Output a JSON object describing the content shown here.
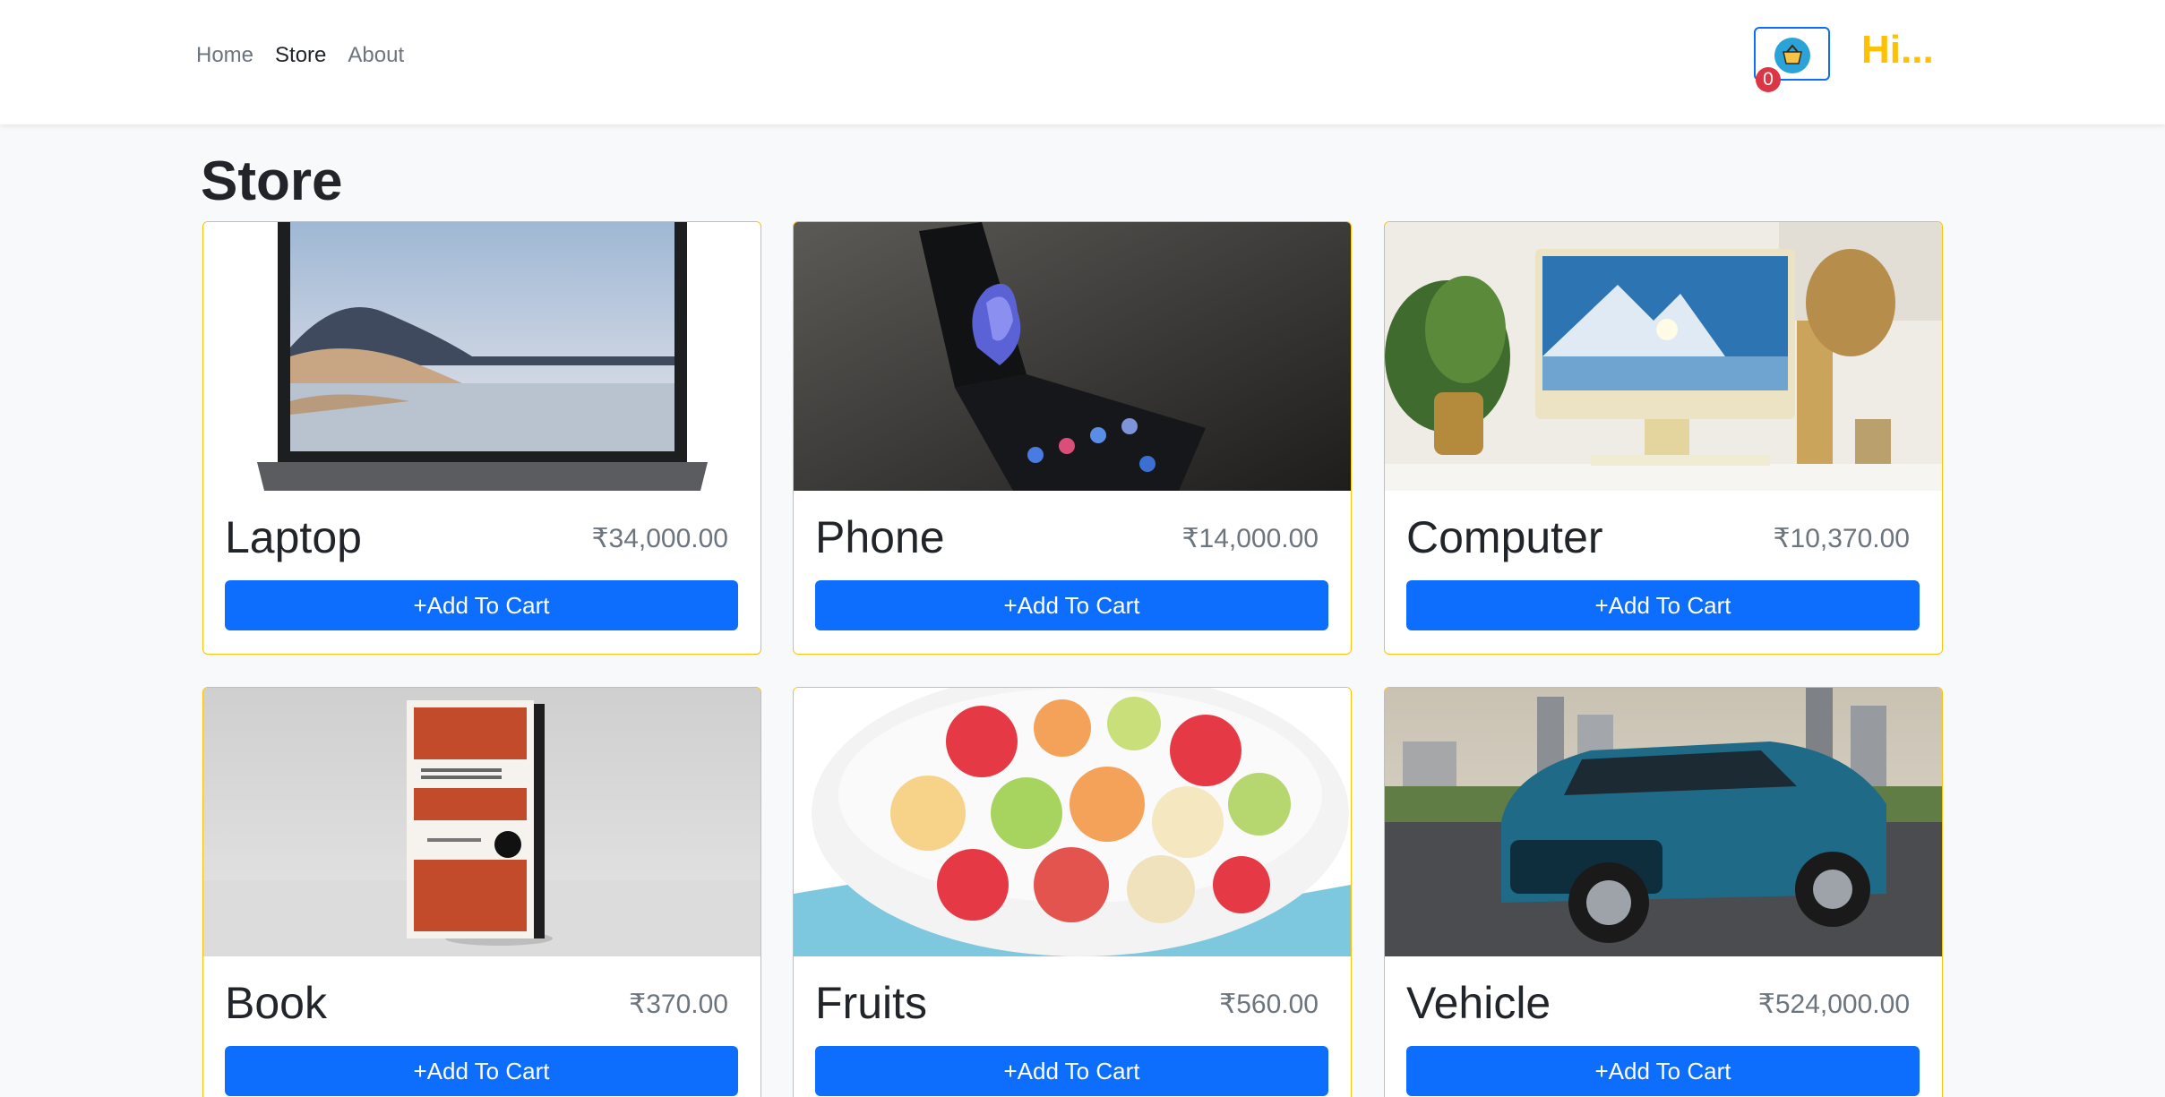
{
  "nav": {
    "links": [
      {
        "label": "Home",
        "active": false
      },
      {
        "label": "Store",
        "active": true
      },
      {
        "label": "About",
        "active": false
      }
    ],
    "cart_count": "0",
    "greeting": "Hi..."
  },
  "page": {
    "title": "Store"
  },
  "products": [
    {
      "name": "Laptop",
      "price": "₹34,000.00",
      "button": "+Add To Cart"
    },
    {
      "name": "Phone",
      "price": "₹14,000.00",
      "button": "+Add To Cart"
    },
    {
      "name": "Computer",
      "price": "₹10,370.00",
      "button": "+Add To Cart"
    },
    {
      "name": "Book",
      "price": "₹370.00",
      "button": "+Add To Cart"
    },
    {
      "name": "Fruits",
      "price": "₹560.00",
      "button": "+Add To Cart"
    },
    {
      "name": "Vehicle",
      "price": "₹524,000.00",
      "button": "+Add To Cart"
    }
  ],
  "colors": {
    "primary": "#0d6efd",
    "accent": "#ffc107",
    "badge": "#dc3545",
    "background": "#f8f9fa"
  },
  "icons": [
    "basket-icon"
  ]
}
